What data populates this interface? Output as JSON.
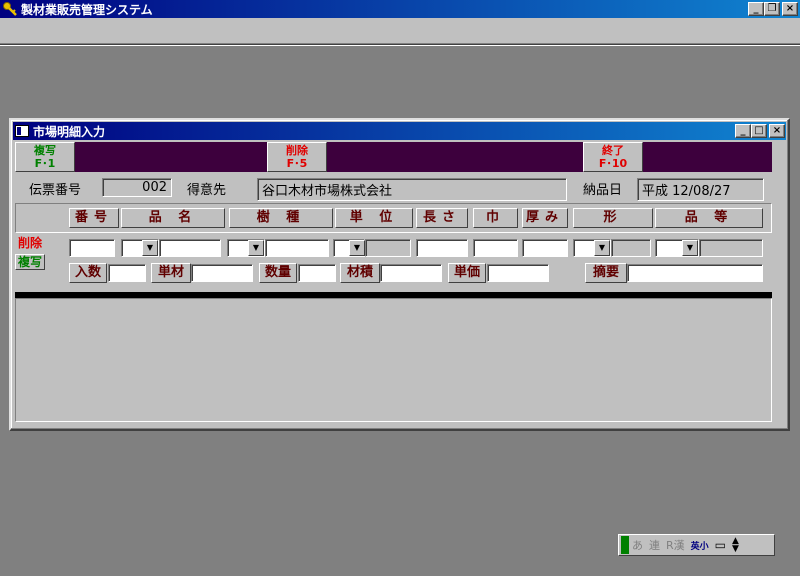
{
  "app": {
    "title": "製材業販売管理システム"
  },
  "window_buttons": {
    "minimize": "_",
    "restore": "❐",
    "close": "×"
  },
  "child": {
    "title": "市場明細入力",
    "fkeys": [
      {
        "line1": "複写",
        "line2": "F･1"
      },
      {
        "line1": "削除",
        "line2": "F･5"
      },
      {
        "line1": "終了",
        "line2": "F･10"
      }
    ],
    "header": {
      "slip_label": "伝票番号",
      "slip_value": "002",
      "customer_label": "得意先",
      "customer_value": "谷口木材市場株式会社",
      "delivery_label": "納品日",
      "delivery_value": "平成 12/08/27"
    },
    "columns": [
      "番号",
      "品 名",
      "樹 種",
      "単 位",
      "長さ",
      "巾",
      "厚み",
      "形",
      "品 等"
    ],
    "side_buttons": {
      "delete": "削除",
      "copy": "複写"
    },
    "sub_labels": {
      "irisu": "入数",
      "tanzai": "単材",
      "suryo": "数量",
      "zaiseki": "材積",
      "tanka": "単価",
      "tekiyo": "摘要"
    }
  },
  "ime": {
    "a": "あ",
    "ren": "連",
    "r": "R漢",
    "eishou": "英小"
  }
}
